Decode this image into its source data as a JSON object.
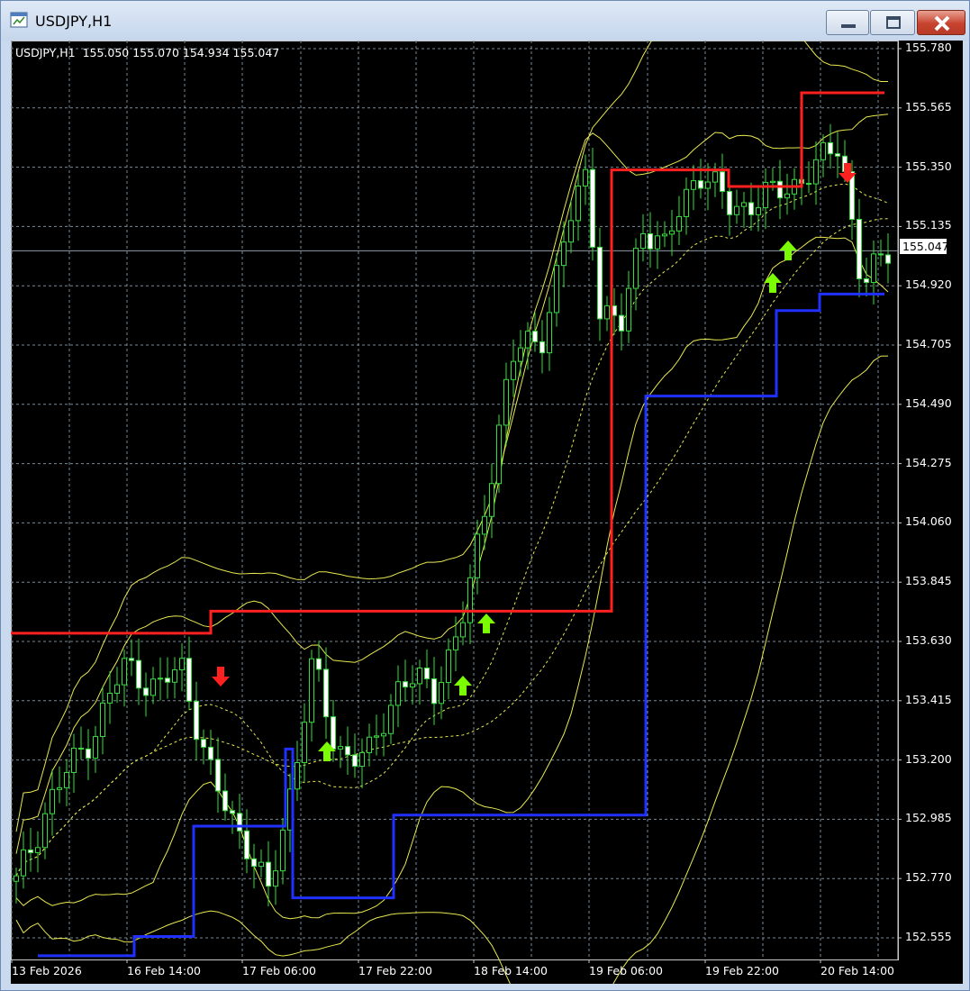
{
  "window": {
    "title": "USDJPY,H1",
    "controls": {
      "minimize": "minimize-icon",
      "maximize": "maximize-icon",
      "close": "close-icon"
    }
  },
  "chart": {
    "symbol_info": "USDJPY,H1  155.050 155.070 154.934 155.047",
    "current_price": "155.047",
    "price_axis": [
      "155.780",
      "155.565",
      "155.350",
      "155.135",
      "154.920",
      "154.705",
      "154.490",
      "154.275",
      "154.060",
      "153.845",
      "153.630",
      "153.415",
      "153.200",
      "152.985",
      "152.770",
      "152.555"
    ],
    "time_axis": [
      "13 Feb 2026",
      "16 Feb 14:00",
      "17 Feb 06:00",
      "17 Feb 22:00",
      "18 Feb 14:00",
      "19 Feb 06:00",
      "19 Feb 22:00",
      "20 Feb 14:00"
    ],
    "colors": {
      "background": "#000000",
      "grid": "#7a8a99",
      "candle": "#32e03a",
      "bands": "#e8e850",
      "resistance": "#ff2020",
      "support": "#2030ff",
      "buy_arrow": "#7cfc00",
      "sell_arrow": "#ff2020"
    }
  },
  "chart_data": {
    "type": "candlestick",
    "symbol": "USDJPY",
    "timeframe": "H1",
    "ohlc_last": {
      "open": 155.05,
      "high": 155.07,
      "low": 154.934,
      "close": 155.047
    },
    "ylim": [
      152.48,
      155.84
    ],
    "resistance_levels": [
      {
        "from": "13 Feb 2026",
        "price": 153.66
      },
      {
        "from": "16 Feb 20:00",
        "price": 153.74
      },
      {
        "from": "19 Feb 05:00",
        "price": 155.34
      },
      {
        "from": "19 Feb 19:00",
        "price": 155.28
      },
      {
        "from": "20 Feb 07:00",
        "price": 155.62
      }
    ],
    "support_levels": [
      {
        "from": "13 Feb 2026",
        "price": 152.49
      },
      {
        "from": "16 Feb 09:00",
        "price": 152.56
      },
      {
        "from": "16 Feb 16:00",
        "price": 152.96
      },
      {
        "from": "16 Feb 19:00",
        "price": 153.24
      },
      {
        "from": "17 Feb 07:00",
        "price": 152.7
      },
      {
        "from": "17 Feb 18:00",
        "price": 153.0
      },
      {
        "from": "19 Feb 09:00",
        "price": 154.52
      },
      {
        "from": "20 Feb 02:00",
        "price": 154.83
      },
      {
        "from": "20 Feb 05:00",
        "price": 154.89
      }
    ],
    "signals": [
      {
        "type": "sell",
        "time": "16 Feb 21:00"
      },
      {
        "type": "buy",
        "time": "17 Feb 13:00"
      },
      {
        "type": "buy",
        "time": "18 Feb 08:00"
      },
      {
        "type": "buy",
        "time": "18 Feb 12:00"
      },
      {
        "type": "buy",
        "time": "20 Feb 04:00"
      },
      {
        "type": "buy",
        "time": "20 Feb 06:00"
      },
      {
        "type": "sell",
        "time": "20 Feb 12:00"
      }
    ]
  }
}
